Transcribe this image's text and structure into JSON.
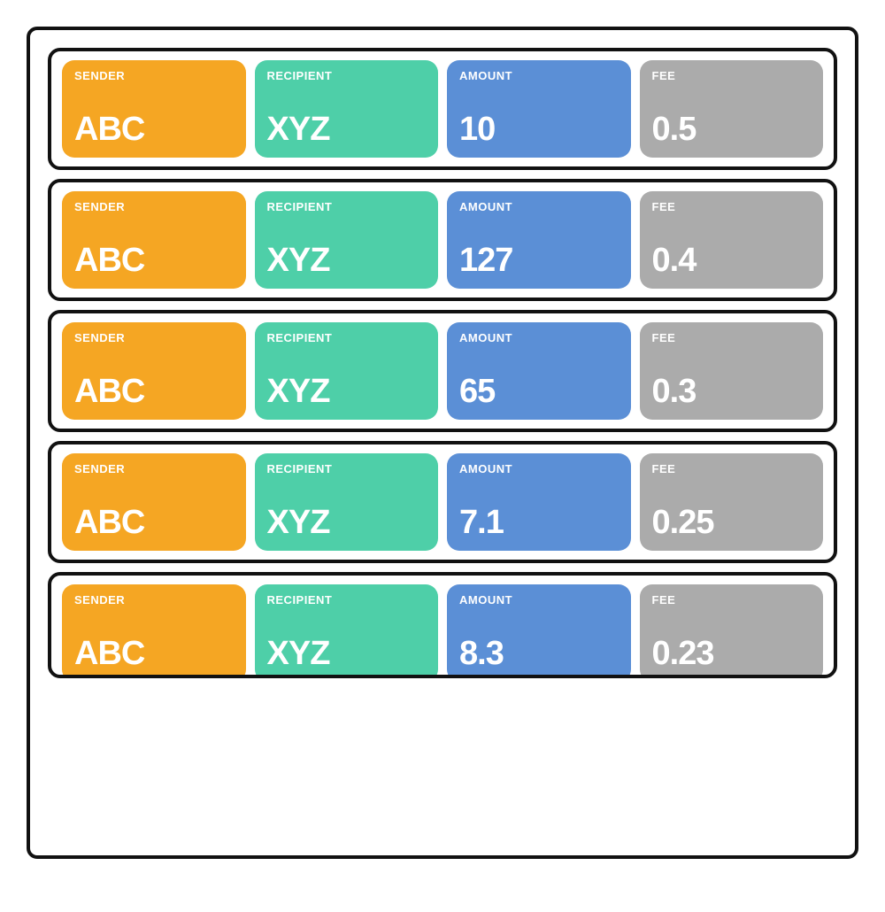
{
  "transactions": [
    {
      "sender": {
        "label": "SENDER",
        "value": "ABC"
      },
      "recipient": {
        "label": "RECIPIENT",
        "value": "XYZ"
      },
      "amount": {
        "label": "AMOUNT",
        "value": "10"
      },
      "fee": {
        "label": "FEE",
        "value": "0.5"
      }
    },
    {
      "sender": {
        "label": "SENDER",
        "value": "ABC"
      },
      "recipient": {
        "label": "RECIPIENT",
        "value": "XYZ"
      },
      "amount": {
        "label": "AMOUNT",
        "value": "127"
      },
      "fee": {
        "label": "FEE",
        "value": "0.4"
      }
    },
    {
      "sender": {
        "label": "SENDER",
        "value": "ABC"
      },
      "recipient": {
        "label": "RECIPIENT",
        "value": "XYZ"
      },
      "amount": {
        "label": "AMOUNT",
        "value": "65"
      },
      "fee": {
        "label": "FEE",
        "value": "0.3"
      }
    },
    {
      "sender": {
        "label": "SENDER",
        "value": "ABC"
      },
      "recipient": {
        "label": "RECIPIENT",
        "value": "XYZ"
      },
      "amount": {
        "label": "AMOUNT",
        "value": "7.1"
      },
      "fee": {
        "label": "FEE",
        "value": "0.25"
      }
    },
    {
      "sender": {
        "label": "SENDER",
        "value": "ABC"
      },
      "recipient": {
        "label": "RECIPIENT",
        "value": "XYZ"
      },
      "amount": {
        "label": "AMOUNT",
        "value": "8.3"
      },
      "fee": {
        "label": "FEE",
        "value": "0.23"
      }
    }
  ]
}
